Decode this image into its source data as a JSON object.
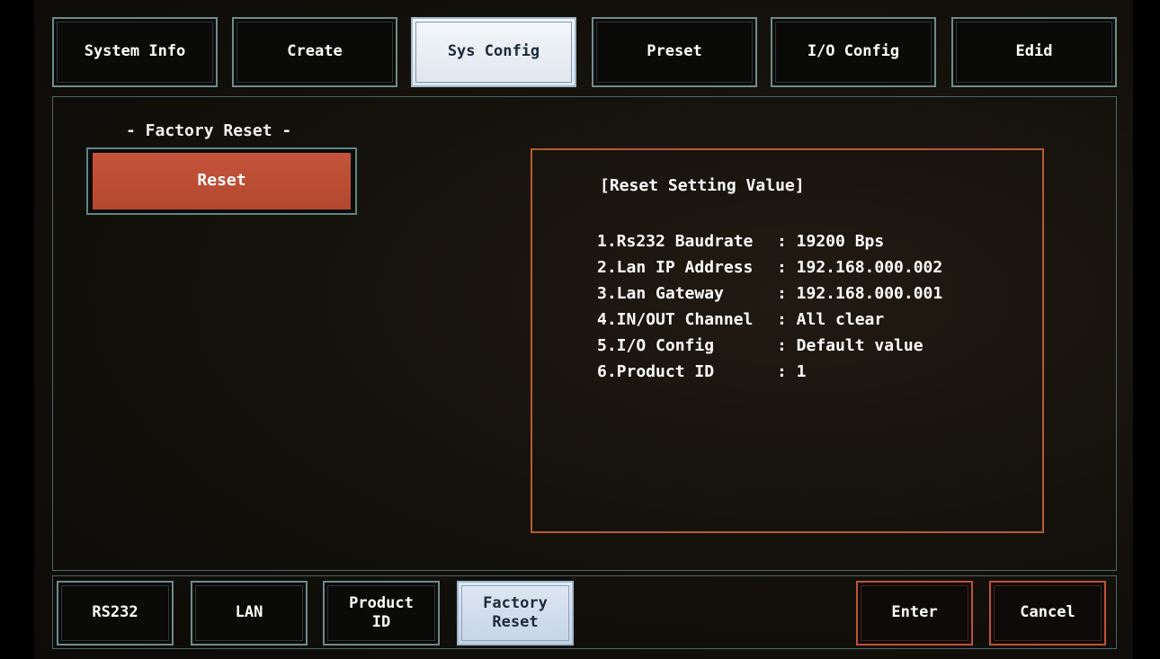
{
  "top_tabs": [
    {
      "label": "System Info",
      "selected": false
    },
    {
      "label": "Create",
      "selected": false
    },
    {
      "label": "Sys Config",
      "selected": true
    },
    {
      "label": "Preset",
      "selected": false
    },
    {
      "label": "I/O Config",
      "selected": false
    },
    {
      "label": "Edid",
      "selected": false
    }
  ],
  "factory_reset": {
    "section_title": "- Factory Reset -",
    "reset_button": "Reset"
  },
  "reset_info": {
    "title": "[Reset Setting Value]",
    "items": [
      {
        "label": "1.Rs232 Baudrate",
        "value": ": 19200 Bps"
      },
      {
        "label": "2.Lan IP Address",
        "value": ": 192.168.000.002"
      },
      {
        "label": "3.Lan Gateway",
        "value": ": 192.168.000.001"
      },
      {
        "label": "4.IN/OUT Channel",
        "value": ": All clear"
      },
      {
        "label": "5.I/O Config",
        "value": ": Default value"
      },
      {
        "label": "6.Product ID",
        "value": ": 1"
      }
    ]
  },
  "sub_tabs": [
    {
      "label": "RS232",
      "selected": false
    },
    {
      "label": "LAN",
      "selected": false
    },
    {
      "label": "Product\nID",
      "selected": false
    },
    {
      "label": "Factory\nReset",
      "selected": true
    }
  ],
  "actions": {
    "enter": "Enter",
    "cancel": "Cancel"
  },
  "colors": {
    "accent_orange": "#c4543b",
    "selected_tab": "#dfe6ef",
    "panel_border": "#4e6566"
  }
}
